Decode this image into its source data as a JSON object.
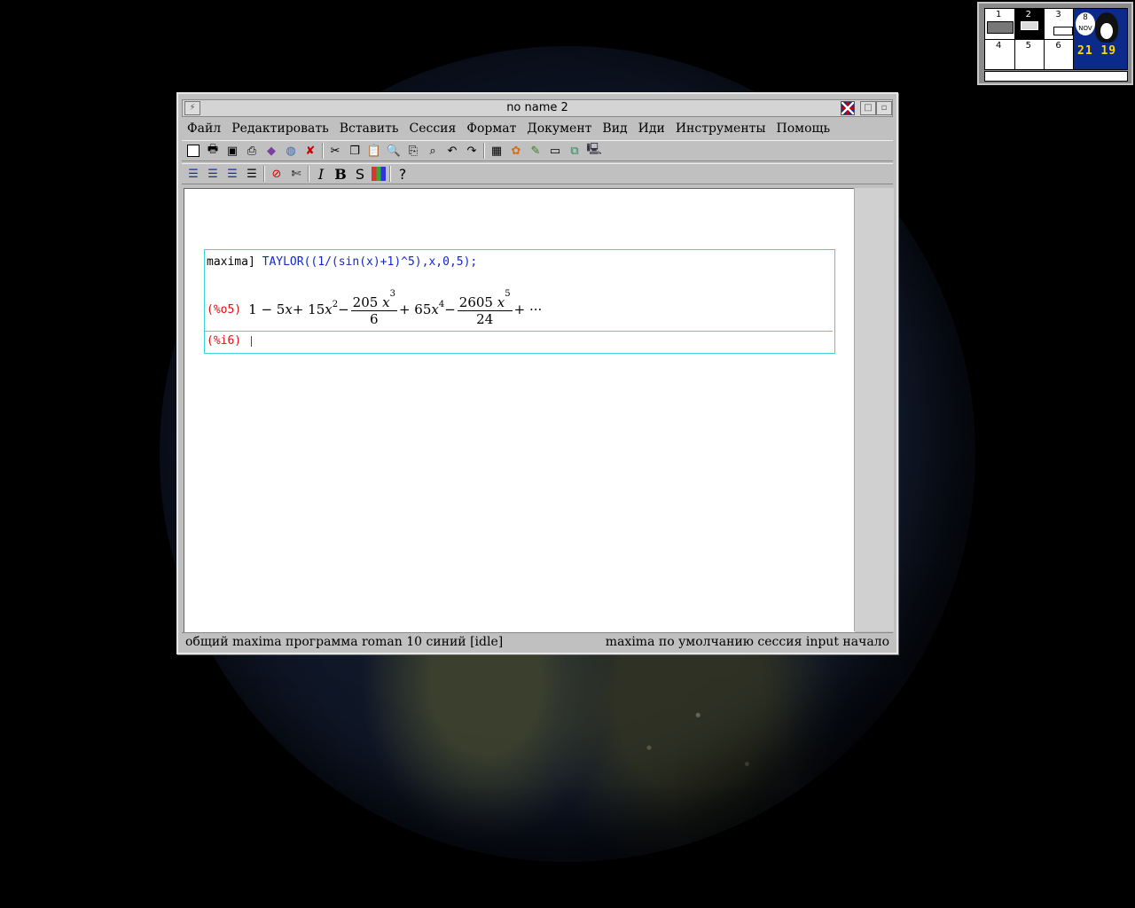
{
  "pager": {
    "desktops": [
      "1",
      "2",
      "3",
      "4",
      "5",
      "6"
    ],
    "active_desktop": "2",
    "date_day": "8",
    "date_month": "NOV",
    "time": "21 19"
  },
  "window": {
    "title": "no name 2"
  },
  "menu": [
    "Файл",
    "Редактировать",
    "Вставить",
    "Сессия",
    "Формат",
    "Документ",
    "Вид",
    "Иди",
    "Инструменты",
    "Помощь"
  ],
  "toolbar1": [
    "new-document-icon",
    "open-icon",
    "save-icon",
    "print-icon",
    "book-icon",
    "web-icon",
    "close-icon",
    "cut-icon",
    "copy-icon",
    "paste-icon",
    "find-icon",
    "replace-icon",
    "search-icon",
    "undo-icon",
    "redo-icon",
    "table-icon",
    "palette-icon",
    "pen-icon",
    "box-icon",
    "image-icon",
    "computer-icon"
  ],
  "toolbar2": [
    "align-left-icon",
    "align-center-icon",
    "align-right-icon",
    "justify-icon",
    "stop-icon",
    "scissors-icon",
    "italic-icon",
    "bold-icon",
    "sans-icon",
    "color-icon",
    "help-icon"
  ],
  "session": {
    "input_prompt": "maxima]",
    "input_command": "TAYLOR((1/(sin(x)+1)^5),x,0,5);",
    "output_label": "(%o5)",
    "output_parts": {
      "t1": "1 − 5",
      "x1": "x",
      "t2": " + 15",
      "x2": "x",
      "e2": "2",
      "minus1": " − ",
      "f1_num_coef": "205",
      "f1_num_x": "x",
      "f1_num_exp": "3",
      "f1_den": "6",
      "t3": " + 65",
      "x4": "x",
      "e4": "4",
      "minus2": " − ",
      "f2_num_coef": "2605",
      "f2_num_x": "x",
      "f2_num_exp": "5",
      "f2_den": "24",
      "tail": " + ···"
    },
    "next_prompt": "(%i6)"
  },
  "status": {
    "left": "общий maxima программа roman 10 синий [idle]",
    "right": "maxima по умолчанию сессия input начало"
  }
}
